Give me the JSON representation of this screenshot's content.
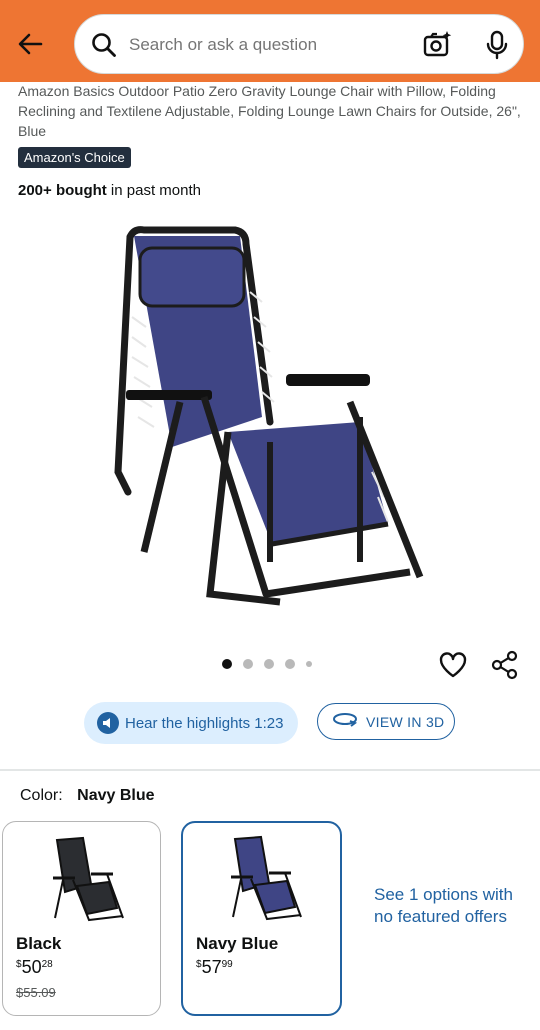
{
  "header": {
    "search_placeholder": "Search or ask a question"
  },
  "product": {
    "title": "Amazon Basics Outdoor Patio Zero Gravity Lounge Chair with Pillow, Folding Reclining and Textilene Adjustable, Folding Lounge Lawn Chairs for Outside, 26\", Blue",
    "badge": "Amazon's Choice",
    "bought_bold": "200+ bought",
    "bought_rest": " in past month",
    "image_count": 5,
    "active_image": 1,
    "hear_highlights": "Hear the highlights 1:23",
    "view_3d": "VIEW IN 3D"
  },
  "color_selector": {
    "label": "Color:",
    "selected": "Navy Blue",
    "options": [
      {
        "name": "Black",
        "price_symbol": "$",
        "price_whole": "50",
        "price_fraction": "28",
        "list_price": "$55.09",
        "chair_color": "#2b2d31"
      },
      {
        "name": "Navy Blue",
        "price_symbol": "$",
        "price_whole": "57",
        "price_fraction": "99",
        "chair_color": "#3f4585"
      }
    ],
    "see_options": "See 1 options with no featured offers"
  },
  "colors": {
    "header_orange": "#ee7533",
    "link_blue": "#2162a1",
    "highlight_bg": "#dceefe",
    "badge_bg": "#232f3e"
  }
}
